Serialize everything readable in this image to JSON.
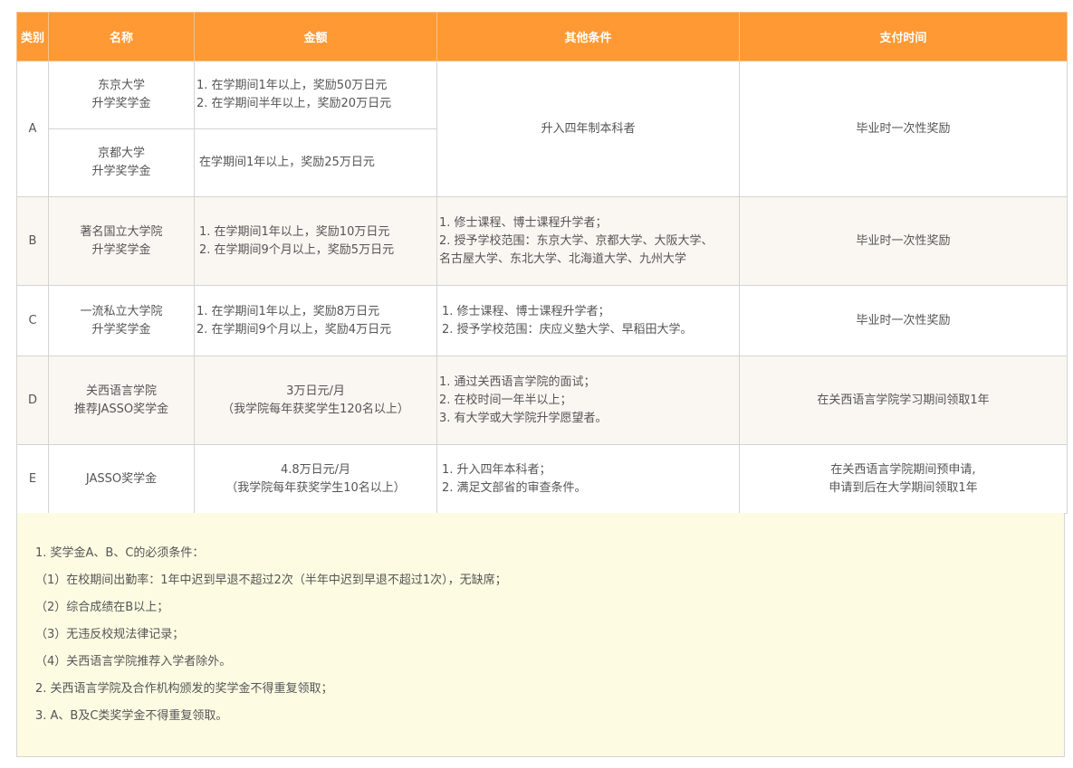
{
  "headers": [
    "类别",
    "名称",
    "金额",
    "其他条件",
    "支付时间"
  ],
  "rows": {
    "a": {
      "cat": "A",
      "conditions": "升入四年制本科者",
      "payment": "毕业时一次性奖励",
      "sub1": {
        "name": [
          "东京大学",
          "升学奖学金"
        ],
        "amount": [
          "1. 在学期间1年以上，奖励50万日元",
          "2. 在学期间半年以上，奖励20万日元"
        ]
      },
      "sub2": {
        "name": [
          "京都大学",
          "升学奖学金"
        ],
        "amount": [
          "在学期间1年以上，奖励25万日元"
        ]
      }
    },
    "b": {
      "cat": "B",
      "name": [
        "著名国立大学院",
        "升学奖学金"
      ],
      "amount": [
        "1. 在学期间1年以上，奖励10万日元",
        "2. 在学期间9个月以上，奖励5万日元"
      ],
      "conditions": [
        "1. 修士课程、博士课程升学者；",
        "2. 授予学校范围：东京大学、京都大学、大阪大学、",
        "名古屋大学、东北大学、北海道大学、九州大学"
      ],
      "payment": "毕业时一次性奖励"
    },
    "c": {
      "cat": "C",
      "name": [
        "一流私立大学院",
        "升学奖学金"
      ],
      "amount": [
        "1. 在学期间1年以上，奖励8万日元",
        "2. 在学期间9个月以上，奖励4万日元"
      ],
      "conditions": [
        "1. 修士课程、博士课程升学者；",
        "2. 授予学校范围：庆应义塾大学、早稻田大学。"
      ],
      "payment": "毕业时一次性奖励"
    },
    "d": {
      "cat": "D",
      "name": [
        "关西语言学院",
        "推荐JASSO奖学金"
      ],
      "amount": [
        "3万日元/月",
        "（我学院每年获奖学生120名以上）"
      ],
      "conditions": [
        "1. 通过关西语言学院的面试；",
        "2. 在校时间一年半以上；",
        "3. 有大学或大学院升学愿望者。"
      ],
      "payment": "在关西语言学院学习期间领取1年"
    },
    "e": {
      "cat": "E",
      "name": "JASSO奖学金",
      "amount": [
        "4.8万日元/月",
        "（我学院每年获奖学生10名以上）"
      ],
      "conditions": [
        "1. 升入四年本科者；",
        "2. 满足文部省的审查条件。"
      ],
      "payment": [
        "在关西语言学院期间预申请,",
        "申请到后在大学期间领取1年"
      ]
    }
  },
  "notes": [
    "1. 奖学金A、B、C的必须条件：",
    "（1）在校期间出勤率：1年中迟到早退不超过2次（半年中迟到早退不超过1次），无缺席；",
    "（2）综合成绩在B以上；",
    "（3）无违反校规法律记录；",
    "（4）关西语言学院推荐入学者除外。",
    "2. 关西语言学院及合作机构颁发的奖学金不得重复领取；",
    "3. A、B及C类奖学金不得重复领取。"
  ],
  "colors": {
    "header_bg": "#ff9933",
    "header_text": "#ffffff",
    "notes_bg": "#fefbe3",
    "alt_row_bg": "#faf7f2"
  }
}
